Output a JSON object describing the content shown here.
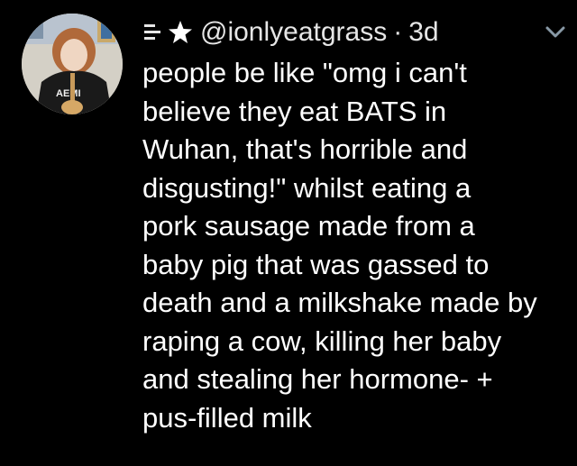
{
  "tweet": {
    "badge_icons": [
      "menu-lines-icon",
      "star-icon"
    ],
    "handle": "@ionlyeatgrass",
    "separator": "·",
    "time": "3d",
    "menu_icon": "chevron-down-icon",
    "body_lines": [
      "people be like \"omg i can't",
      "believe they eat BATS in",
      "Wuhan, that's horrible and",
      "disgusting!\" whilst eating a",
      "pork sausage made from a",
      "baby pig that was gassed to",
      "death and a milkshake made by",
      "raping a cow, killing her baby",
      "and stealing her hormone- +",
      "pus-filled milk"
    ]
  },
  "avatar": {
    "shirt_text": "AЕMI"
  },
  "colors": {
    "background": "#000000",
    "text": "#ffffff",
    "secondary": "#e6e6e6",
    "chevron": "#8899a6"
  }
}
